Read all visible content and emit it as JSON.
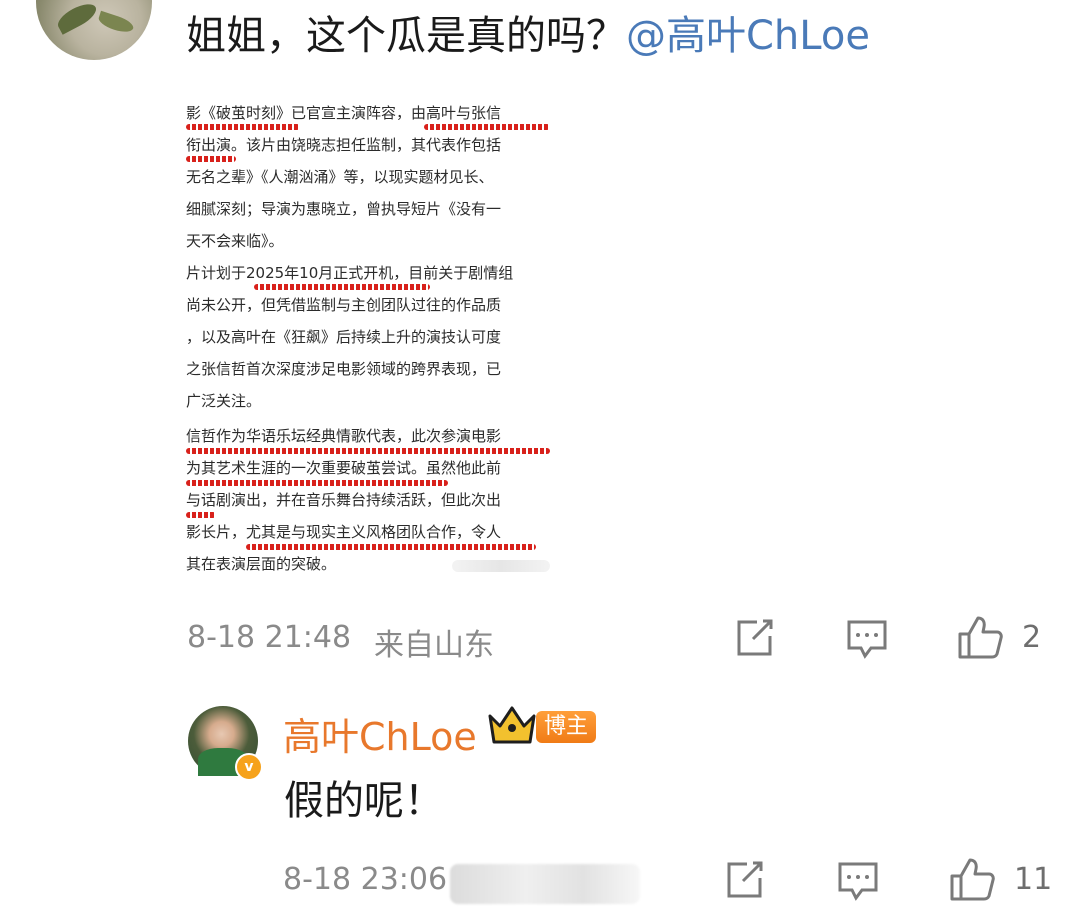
{
  "comment": {
    "text": "姐姐，这个瓜是真的吗？",
    "mention": "@高叶ChLoe",
    "time": "8-18 21:48",
    "location": "来自山东",
    "like_count": "2"
  },
  "screenshot_lines": [
    "影《破茧时刻》已官宣主演阵容，由高叶与张信",
    "衔出演。该片由饶晓志担任监制，其代表作包括",
    "无名之辈》《人潮汹涌》等，以现实题材见长、",
    "细腻深刻；导演为惠晓立，曾执导短片《没有一",
    "天不会来临》。",
    "片计划于2025年10月正式开机，目前关于剧情组",
    "尚未公开，但凭借监制与主创团队过往的作品质",
    "，以及高叶在《狂飙》后持续上升的演技认可度",
    "之张信哲首次深度涉足电影领域的跨界表现，已",
    "广泛关注。",
    "信哲作为华语乐坛经典情歌代表，此次参演电影",
    "为其艺术生涯的一次重要破茧尝试。虽然他此前",
    "与话剧演出，并在音乐舞台持续活跃，但此次出",
    "影长片，尤其是与现实主义风格团队合作，令人",
    "其在表演层面的突破。"
  ],
  "reply": {
    "name": "高叶ChLoe",
    "badge": "博主",
    "verified_mark": "v",
    "text": "假的呢！",
    "time": "8-18 23:06",
    "like_count": "11"
  },
  "icons": {
    "share": "share-icon",
    "comment": "comment-icon",
    "like": "thumbs-up-icon"
  },
  "colors": {
    "mention": "#4a7ab8",
    "reply_name": "#e8782c",
    "badge": "#f07b16",
    "underline": "#d8211b"
  }
}
